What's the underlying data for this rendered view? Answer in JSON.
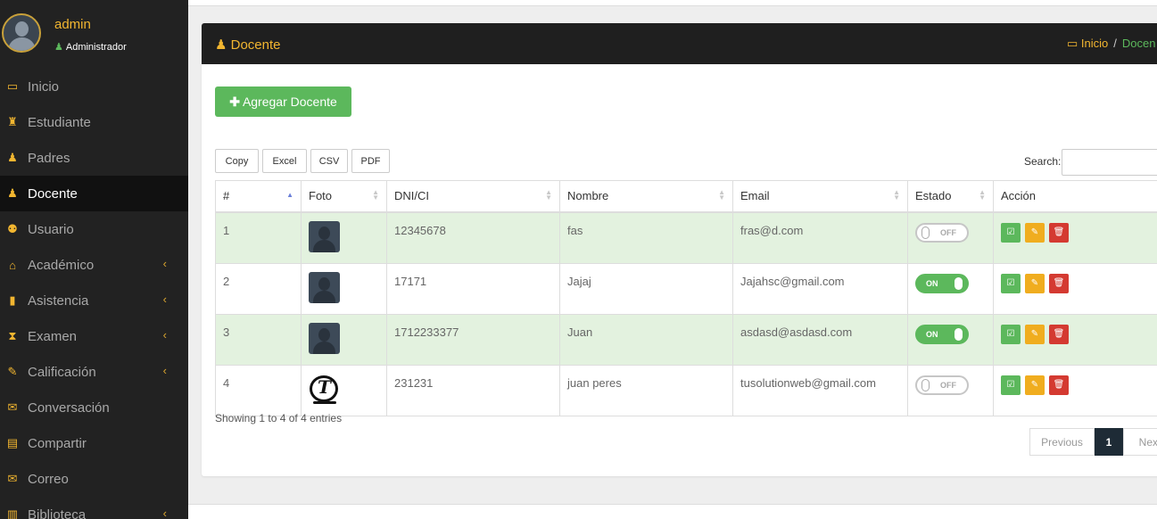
{
  "user": {
    "name": "admin",
    "role": "Administrador"
  },
  "sidebar": {
    "items": [
      {
        "label": "Inicio",
        "icon": "laptop-icon",
        "glyph": "▭",
        "caret": ""
      },
      {
        "label": "Estudiante",
        "icon": "graduate-icon",
        "glyph": "♜",
        "caret": ""
      },
      {
        "label": "Padres",
        "icon": "user-icon",
        "glyph": "♟",
        "caret": ""
      },
      {
        "label": "Docente",
        "icon": "teacher-icon",
        "glyph": "♟",
        "caret": ""
      },
      {
        "label": "Usuario",
        "icon": "users-icon",
        "glyph": "⚉",
        "caret": ""
      },
      {
        "label": "Académico",
        "icon": "school-icon",
        "glyph": "⌂",
        "caret": "‹"
      },
      {
        "label": "Asistencia",
        "icon": "clipboard-icon",
        "glyph": "▮",
        "caret": "‹"
      },
      {
        "label": "Examen",
        "icon": "hourglass-icon",
        "glyph": "⧗",
        "caret": "‹"
      },
      {
        "label": "Calificación",
        "icon": "edit-icon",
        "glyph": "✎",
        "caret": "‹"
      },
      {
        "label": "Conversación",
        "icon": "envelope-icon",
        "glyph": "✉",
        "caret": ""
      },
      {
        "label": "Compartir",
        "icon": "film-icon",
        "glyph": "▤",
        "caret": ""
      },
      {
        "label": "Correo",
        "icon": "envelope-open-icon",
        "glyph": "✉",
        "caret": ""
      },
      {
        "label": "Biblioteca",
        "icon": "books-icon",
        "glyph": "▥",
        "caret": "‹"
      }
    ]
  },
  "header": {
    "title": "Docente",
    "breadcrumb_home": "Inicio",
    "breadcrumb_sep": "/",
    "breadcrumb_current": "Docen"
  },
  "toolbar": {
    "add_label": "Agregar Docente",
    "export": [
      "Copy",
      "Excel",
      "CSV",
      "PDF"
    ],
    "search_label": "Search:",
    "search_value": ""
  },
  "table": {
    "columns": [
      "#",
      "Foto",
      "DNI/CI",
      "Nombre",
      "Email",
      "Estado",
      "Acción"
    ],
    "rows": [
      {
        "num": "1",
        "dni": "12345678",
        "nombre": "fas",
        "email": "fras@d.com",
        "estado": "OFF"
      },
      {
        "num": "2",
        "dni": "17171",
        "nombre": "Jajaj",
        "email": "Jajahsc@gmail.com",
        "estado": "ON"
      },
      {
        "num": "3",
        "dni": "1712233377",
        "nombre": "Juan",
        "email": "asdasd@asdasd.com",
        "estado": "ON"
      },
      {
        "num": "4",
        "dni": "231231",
        "nombre": "juan peres",
        "email": "tusolutionweb@gmail.com",
        "estado": "OFF"
      }
    ]
  },
  "info": "Showing 1 to 4 of 4 entries",
  "pager": {
    "prev": "Previous",
    "current": "1",
    "next": "Next"
  },
  "colors": {
    "accent": "#f2b630",
    "success": "#5cb85c",
    "danger": "#d43a31",
    "warning": "#f0ad1f",
    "sidebar_bg": "#222222"
  }
}
